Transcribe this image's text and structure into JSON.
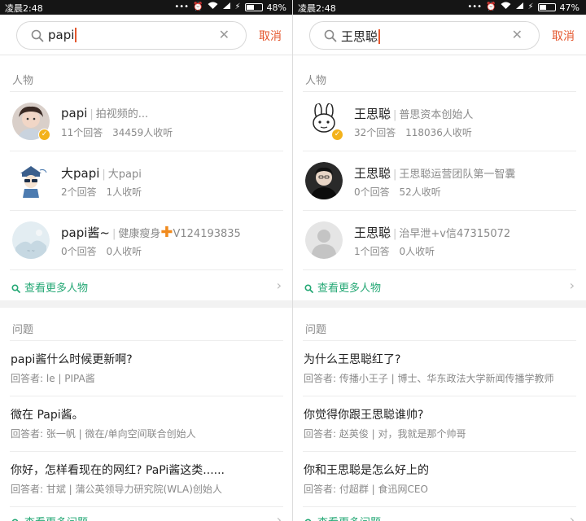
{
  "left": {
    "status": {
      "time": "凌晨2:48",
      "battery_pct": "48%",
      "battery_level": 0.48
    },
    "search": {
      "query": "papi",
      "cancel": "取消"
    },
    "people": {
      "label": "人物",
      "items": [
        {
          "name": "papi",
          "sep": "|",
          "desc": "拍视频的...",
          "answers": "11个回答",
          "followers": "34459人收听",
          "verified": true,
          "plus": false,
          "desc2": ""
        },
        {
          "name": "大papi",
          "sep": "|",
          "desc": "大papi",
          "answers": "2个回答",
          "followers": "1人收听",
          "verified": false,
          "plus": false,
          "desc2": ""
        },
        {
          "name": "papi酱~",
          "sep": "|",
          "desc": "健康瘦身",
          "answers": "0个回答",
          "followers": "0人收听",
          "verified": false,
          "plus": true,
          "desc2": "V124193835"
        }
      ],
      "more": "查看更多人物"
    },
    "questions": {
      "label": "问题",
      "items": [
        {
          "title": "papi酱什么时候更新啊?",
          "meta": "回答者: le | PIPA酱"
        },
        {
          "title": "微在 Papi酱。",
          "meta": "回答者: 张一帆 | 微在/单向空间联合创始人"
        },
        {
          "title": "你好，怎样看现在的网红? PaPi酱这类......",
          "meta": "回答者: 甘斌 | 蒲公英领导力研究院(WLA)创始人"
        }
      ],
      "more": "查看更多问题"
    }
  },
  "right": {
    "status": {
      "time": "凌晨2:48",
      "battery_pct": "47%",
      "battery_level": 0.47
    },
    "search": {
      "query": "王思聪",
      "cancel": "取消"
    },
    "people": {
      "label": "人物",
      "items": [
        {
          "name": "王思聪",
          "sep": "|",
          "desc": "普思资本创始人",
          "answers": "32个回答",
          "followers": "118036人收听",
          "verified": true,
          "plus": false,
          "desc2": ""
        },
        {
          "name": "王思聪",
          "sep": "|",
          "desc": "王思聪运营团队第一智囊",
          "answers": "0个回答",
          "followers": "52人收听",
          "verified": false,
          "plus": false,
          "desc2": ""
        },
        {
          "name": "王思聪",
          "sep": "|",
          "desc": "治早泄+v信47315072",
          "answers": "1个回答",
          "followers": "0人收听",
          "verified": false,
          "plus": false,
          "desc2": ""
        }
      ],
      "more": "查看更多人物"
    },
    "questions": {
      "label": "问题",
      "items": [
        {
          "title": "为什么王思聪红了?",
          "meta": "回答者: 传播小王子 | 博士、华东政法大学新闻传播学教师"
        },
        {
          "title": "你觉得你跟王思聪谁帅?",
          "meta": "回答者: 赵英俊 | 对，我就是那个帅哥"
        },
        {
          "title": "你和王思聪是怎么好上的",
          "meta": "回答者: 付超群 | 食迅网CEO"
        }
      ],
      "more": "查看更多问题"
    }
  },
  "colors": {
    "accent_red": "#e4572e",
    "link_green": "#25a875",
    "verified_gold": "#f3b21b"
  },
  "icons": {
    "status": [
      "alarm-clock-icon",
      "wifi-icon",
      "signal-icon",
      "charging-icon",
      "battery-icon"
    ],
    "search": "search-icon",
    "clear": "clear-icon",
    "more": "chevron-right-icon"
  }
}
